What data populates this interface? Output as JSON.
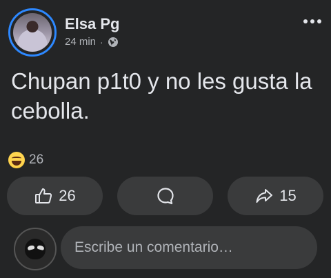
{
  "post": {
    "author": "Elsa Pg",
    "time": "24 min",
    "separator": "·",
    "text": "Chupan p1t0 y no les gusta la cebolla."
  },
  "reactions": {
    "emoji": "laughing-emoji",
    "count": "26"
  },
  "actions": {
    "like_count": "26",
    "share_count": "15"
  },
  "comment": {
    "placeholder": "Escribe un comentario…"
  },
  "colors": {
    "background": "#242526",
    "button_bg": "#3a3b3c",
    "avatar_ring": "#2d88ff",
    "text_primary": "#e4e6eb",
    "text_secondary": "#b0b3b8"
  }
}
